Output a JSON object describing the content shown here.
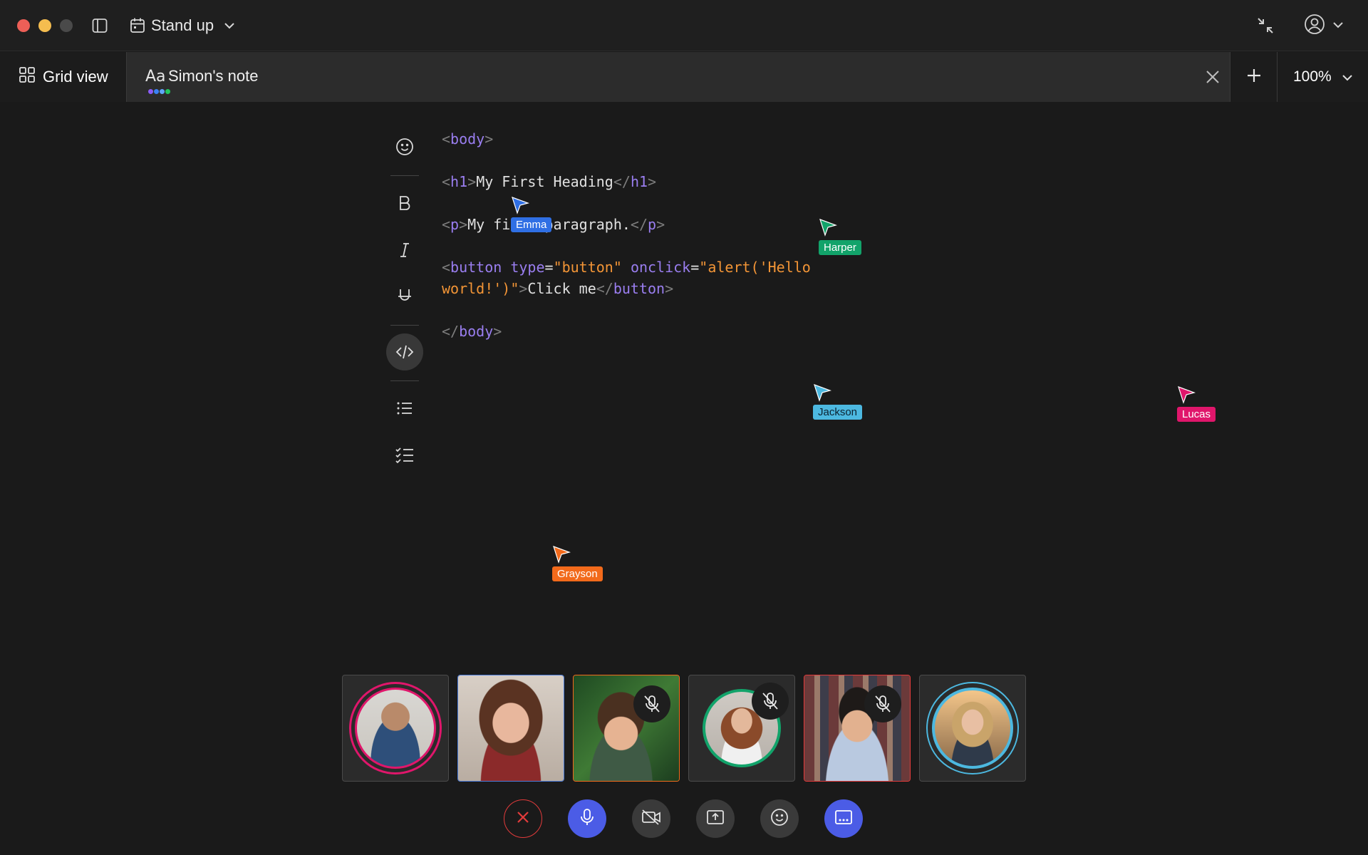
{
  "window": {
    "meeting_title": "Stand up"
  },
  "tabs": {
    "grid_view_label": "Grid view",
    "active_tab_icon": "Aa",
    "active_tab_label": "Simon's note",
    "presence_dot_colors": [
      "#8b5cf6",
      "#3b82f6",
      "#60a5fa",
      "#22c55e"
    ],
    "zoom_value": "100%"
  },
  "toolbar": {
    "items": [
      "emoji-icon",
      "bold-icon",
      "italic-icon",
      "underline-icon",
      "code-block-icon",
      "bullet-list-icon",
      "checklist-icon"
    ],
    "active": "code-block-icon"
  },
  "editor": {
    "code_lines": [
      {
        "tokens": [
          {
            "t": "<",
            "c": "punc"
          },
          {
            "t": "body",
            "c": "tag"
          },
          {
            "t": ">",
            "c": "punc"
          }
        ]
      },
      {
        "tokens": [
          {
            "t": "<",
            "c": "punc"
          },
          {
            "t": "h1",
            "c": "tag"
          },
          {
            "t": ">",
            "c": "punc"
          },
          {
            "t": "My First Heading",
            "c": "text"
          },
          {
            "t": "</",
            "c": "punc"
          },
          {
            "t": "h1",
            "c": "tag"
          },
          {
            "t": ">",
            "c": "punc"
          }
        ]
      },
      {
        "tokens": [
          {
            "t": "<",
            "c": "punc"
          },
          {
            "t": "p",
            "c": "tag"
          },
          {
            "t": ">",
            "c": "punc"
          },
          {
            "t": "My first paragraph.",
            "c": "text"
          },
          {
            "t": "</",
            "c": "punc"
          },
          {
            "t": "p",
            "c": "tag"
          },
          {
            "t": ">",
            "c": "punc"
          }
        ]
      },
      {
        "tokens": [
          {
            "t": "<",
            "c": "punc"
          },
          {
            "t": "button",
            "c": "tag"
          },
          {
            "t": " ",
            "c": "text"
          },
          {
            "t": "type",
            "c": "attr"
          },
          {
            "t": "=",
            "c": "text"
          },
          {
            "t": "\"button\"",
            "c": "str"
          },
          {
            "t": " ",
            "c": "text"
          },
          {
            "t": "onclick",
            "c": "attr"
          },
          {
            "t": "=",
            "c": "text"
          },
          {
            "t": "\"alert('Hello",
            "c": "str"
          }
        ]
      },
      {
        "tokens": [
          {
            "t": "world!')\"",
            "c": "str"
          },
          {
            "t": ">",
            "c": "punc"
          },
          {
            "t": "Click me",
            "c": "text"
          },
          {
            "t": "</",
            "c": "punc"
          },
          {
            "t": "button",
            "c": "tag"
          },
          {
            "t": ">",
            "c": "punc"
          }
        ]
      },
      {
        "tokens": [
          {
            "t": "</",
            "c": "punc"
          },
          {
            "t": "body",
            "c": "tag"
          },
          {
            "t": ">",
            "c": "punc"
          }
        ]
      }
    ]
  },
  "cursors": [
    {
      "name": "Emma",
      "color": "#2f6fe4"
    },
    {
      "name": "Harper",
      "color": "#12a36a"
    },
    {
      "name": "Jackson",
      "color": "#4cb8e0"
    },
    {
      "name": "Lucas",
      "color": "#e0166b"
    },
    {
      "name": "Grayson",
      "color": "#f26a1b"
    }
  ],
  "participants": [
    {
      "id": "p1",
      "ring_color": "#e0166b",
      "muted": false,
      "video": false
    },
    {
      "id": "p2",
      "border_color": "#4a7bd8",
      "muted": false,
      "video": true
    },
    {
      "id": "p3",
      "border_color": "#f26a1b",
      "muted": true,
      "video": true
    },
    {
      "id": "p4",
      "ring_color": "#12a36a",
      "muted": true,
      "video": false
    },
    {
      "id": "p5",
      "border_color": "#e23b3b",
      "muted": true,
      "video": true
    },
    {
      "id": "p6",
      "ring_color": "#4cb8e0",
      "muted": false,
      "video": false
    }
  ],
  "controls": [
    {
      "name": "leave-call-button",
      "icon": "close-icon",
      "color": "#e23b3b"
    },
    {
      "name": "microphone-button",
      "icon": "microphone-icon",
      "color": "#4b5ce6"
    },
    {
      "name": "camera-toggle-button",
      "icon": "camera-off-icon",
      "color": "#3a3a3a"
    },
    {
      "name": "share-screen-button",
      "icon": "share-screen-icon",
      "color": "#3a3a3a"
    },
    {
      "name": "reactions-button",
      "icon": "emoji-icon",
      "color": "#3a3a3a"
    },
    {
      "name": "captions-button",
      "icon": "captions-icon",
      "color": "#4b5ce6"
    }
  ]
}
